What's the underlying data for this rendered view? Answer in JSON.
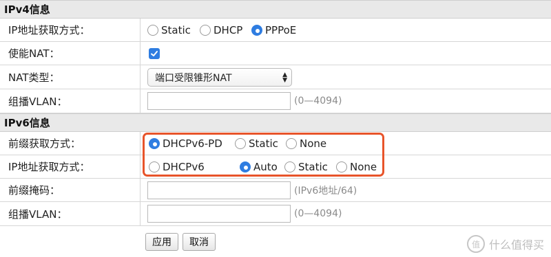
{
  "ipv4": {
    "header": "IPv4信息",
    "ip_method_label": "IP地址获取方式：",
    "ip_methods": [
      {
        "label": "Static",
        "selected": false
      },
      {
        "label": "DHCP",
        "selected": false
      },
      {
        "label": "PPPoE",
        "selected": true
      }
    ],
    "nat_label": "使能NAT：",
    "nat_enabled": true,
    "nat_type_label": "NAT类型：",
    "nat_type_value": "端口受限锥形NAT",
    "vlan_label": "组播VLAN：",
    "vlan_value": "",
    "vlan_hint": "(0—4094)"
  },
  "ipv6": {
    "header": "IPv6信息",
    "prefix_method_label": "前缀获取方式：",
    "prefix_methods": [
      {
        "label": "DHCPv6-PD",
        "selected": true
      },
      {
        "label": "Static",
        "selected": false
      },
      {
        "label": "None",
        "selected": false
      }
    ],
    "ip_method_label": "IP地址获取方式：",
    "ip_methods": [
      {
        "label": "DHCPv6",
        "selected": false
      },
      {
        "label": "Auto",
        "selected": true
      },
      {
        "label": "Static",
        "selected": false
      },
      {
        "label": "None",
        "selected": false
      }
    ],
    "prefix_mask_label": "前缀掩码：",
    "prefix_mask_value": "",
    "prefix_mask_hint": "(IPv6地址/64)",
    "vlan_label": "组播VLAN：",
    "vlan_value": "",
    "vlan_hint": "(0—4094)"
  },
  "buttons": {
    "apply": "应用",
    "cancel": "取消"
  },
  "watermark": {
    "badge": "值",
    "text": "什么值得买"
  },
  "colors": {
    "accent": "#2f7de1",
    "highlight": "#e8542a",
    "header_bg": "#e9e9e9"
  }
}
